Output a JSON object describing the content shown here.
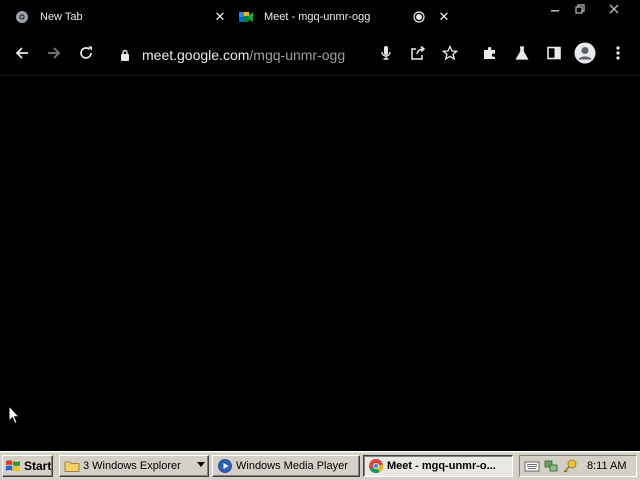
{
  "browser": {
    "tabs": [
      {
        "title": "New Tab"
      },
      {
        "title": "Meet - mgq-unmr-ogg"
      }
    ],
    "url_host": "meet.google.com",
    "url_path": "/mgq-unmr-ogg",
    "icons": {
      "tab1_favicon": "chrome-icon",
      "tab2_favicon": "meet-icon",
      "recording": "recording-icon",
      "back": "arrow-left-icon",
      "forward": "arrow-right-icon",
      "reload": "reload-icon",
      "lock": "lock-icon",
      "mic": "microphone-icon",
      "share": "share-icon",
      "bookmark": "star-icon",
      "extensions": "puzzle-icon",
      "labs": "flask-icon",
      "side_panel": "side-panel-icon",
      "profile": "profile-icon",
      "menu": "kebab-menu-icon"
    }
  },
  "taskbar": {
    "start_label": "Start",
    "tasks": [
      {
        "label": "3 Windows Explorer",
        "icon": "folder-icon"
      },
      {
        "label": "Windows Media Player",
        "icon": "media-player-icon"
      },
      {
        "label": "Meet - mgq-unmr-o...",
        "icon": "chrome-icon",
        "active": true
      }
    ],
    "clock": "8:11 AM"
  },
  "colors": {
    "browser_bg": "#000000",
    "browser_text": "#e8eaed",
    "taskbar_bg": "#d4d0c8"
  }
}
